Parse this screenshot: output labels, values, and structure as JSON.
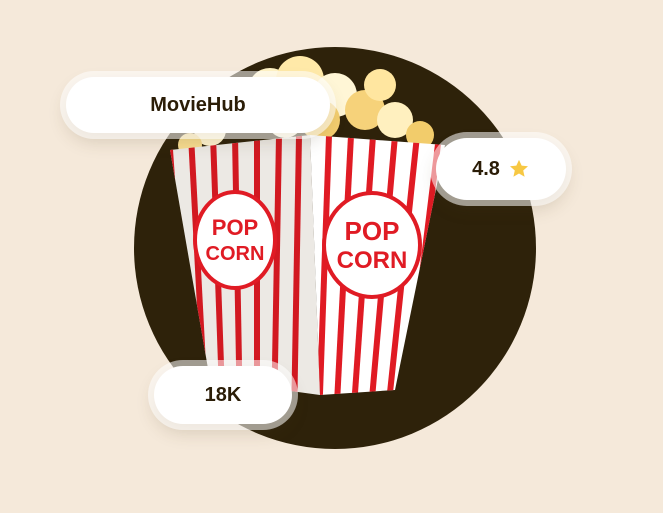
{
  "brand": {
    "name": "MovieHub"
  },
  "rating": {
    "value": "4.8",
    "icon": "star-icon",
    "star_color": "#f7c843"
  },
  "audience": {
    "count": "18K"
  },
  "illustration": {
    "icon": "popcorn-box",
    "label_line1": "POP",
    "label_line2": "CORN",
    "stripe_color": "#e01b24",
    "circle_color": "#2e220a"
  }
}
